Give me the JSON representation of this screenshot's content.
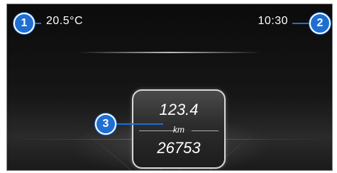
{
  "status_bar": {
    "temperature": "20.5°C",
    "time": "10:30"
  },
  "trip_card": {
    "trip_distance": "123.4",
    "unit": "km",
    "odometer": "26753"
  },
  "callouts": {
    "one": "1",
    "two": "2",
    "three": "3"
  },
  "colors": {
    "callout": "#1f6fd1",
    "background": "#111111"
  }
}
